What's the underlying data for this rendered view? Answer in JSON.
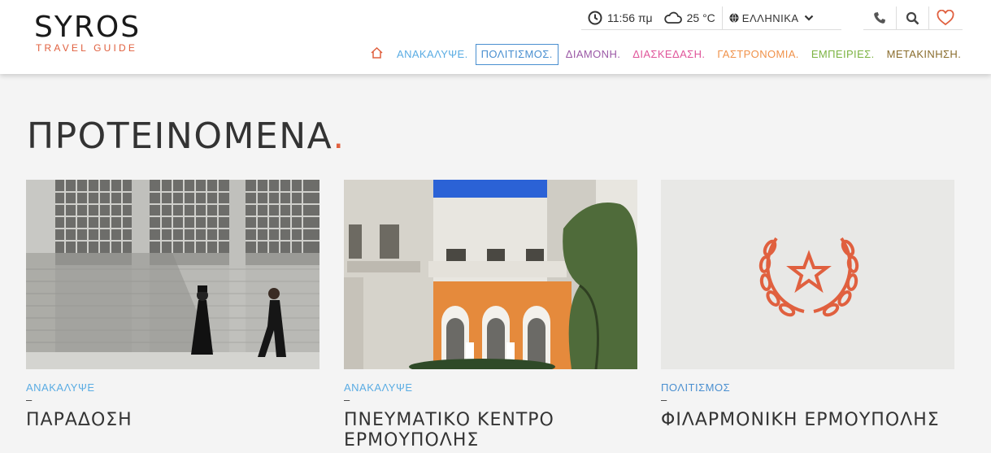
{
  "header": {
    "logo": {
      "main": "SYROS",
      "sub": "TRAVEL GUIDE"
    },
    "time": "11:56 πμ",
    "weather": "25 °C",
    "language": "ΕΛΛΗΝΙΚΑ",
    "icons": [
      "clock-icon",
      "cloud-icon",
      "globe-icon",
      "chevron-down-icon",
      "phone-icon",
      "search-icon",
      "heart-icon"
    ]
  },
  "nav": {
    "items": [
      {
        "label": "ΑΝΑΚΑΛΥΨΕ.",
        "color": "#5aace3"
      },
      {
        "label": "ΠΟΛΙΤΙΣΜΟΣ.",
        "color": "#4a8fd0",
        "active": true
      },
      {
        "label": "ΔΙΑΜΟΝΗ.",
        "color": "#9b59a6"
      },
      {
        "label": "ΔΙΑΣΚΕΔΑΣΗ.",
        "color": "#e0559a"
      },
      {
        "label": "ΓΑΣΤΡΟΝΟΜΙΑ.",
        "color": "#f0924a"
      },
      {
        "label": "ΕΜΠΕΙΡΙΕΣ.",
        "color": "#7cb342"
      },
      {
        "label": "ΜΕΤΑΚΙΝΗΣΗ.",
        "color": "#8a6d2e"
      }
    ],
    "home_color": "#e0603f"
  },
  "main": {
    "section_title": "ΠΡΟΤΕΙΝΟΜΕΝΑ",
    "section_dot": ".",
    "cards": [
      {
        "category": "ΑΝΑΚΑΛΥΨΕ",
        "category_color": "#5aace3",
        "dash": "–",
        "title": "ΠΑΡΑΔΟΣΗ"
      },
      {
        "category": "ΑΝΑΚΑΛΥΨΕ",
        "category_color": "#5aace3",
        "dash": "–",
        "title": "ΠΝΕΥΜΑΤΙΚΟ ΚΕΝΤΡΟ ΕΡΜΟΥΠΟΛΗΣ"
      },
      {
        "category": "ΠΟΛΙΤΙΣΜΟΣ",
        "category_color": "#4a8fd0",
        "dash": "–",
        "title": "ΦΙΛΑΡΜΟΝΙΚΗ ΕΡΜΟΥΠΟΛΗΣ"
      }
    ]
  },
  "colors": {
    "accent": "#e0603f"
  }
}
